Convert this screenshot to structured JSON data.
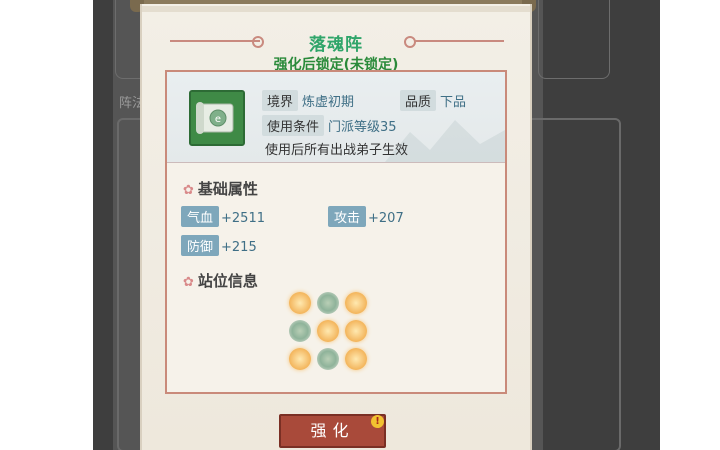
{
  "popup": {
    "title": "落魂阵",
    "subtitle": "强化后锁定(未锁定)"
  },
  "item": {
    "icon": "scroll-formation-icon",
    "realm_label": "境界",
    "realm_value": "炼虚初期",
    "quality_label": "品质",
    "quality_value": "下品",
    "condition_label": "使用条件",
    "condition_value": "门派等级35",
    "effect_text": "使用后所有出战弟子生效"
  },
  "base_attributes": {
    "header": "基础属性",
    "stats": [
      {
        "label": "气血",
        "value": "+2511"
      },
      {
        "label": "攻击",
        "value": "+207"
      },
      {
        "label": "防御",
        "value": "+215"
      }
    ]
  },
  "position_info": {
    "header": "站位信息",
    "grid": [
      [
        "gold",
        "green",
        "gold"
      ],
      [
        "green",
        "gold",
        "gold"
      ],
      [
        "gold",
        "green",
        "gold"
      ]
    ]
  },
  "actions": {
    "enhance_label": "强化",
    "badge": "!"
  },
  "background": {
    "label": "阵法"
  },
  "colors": {
    "title": "#2fa56a",
    "subtitle": "#2a8a3a",
    "button": "#a94a3a",
    "stat_tag": "#7ea7bb",
    "value_text": "#3f6f86"
  }
}
